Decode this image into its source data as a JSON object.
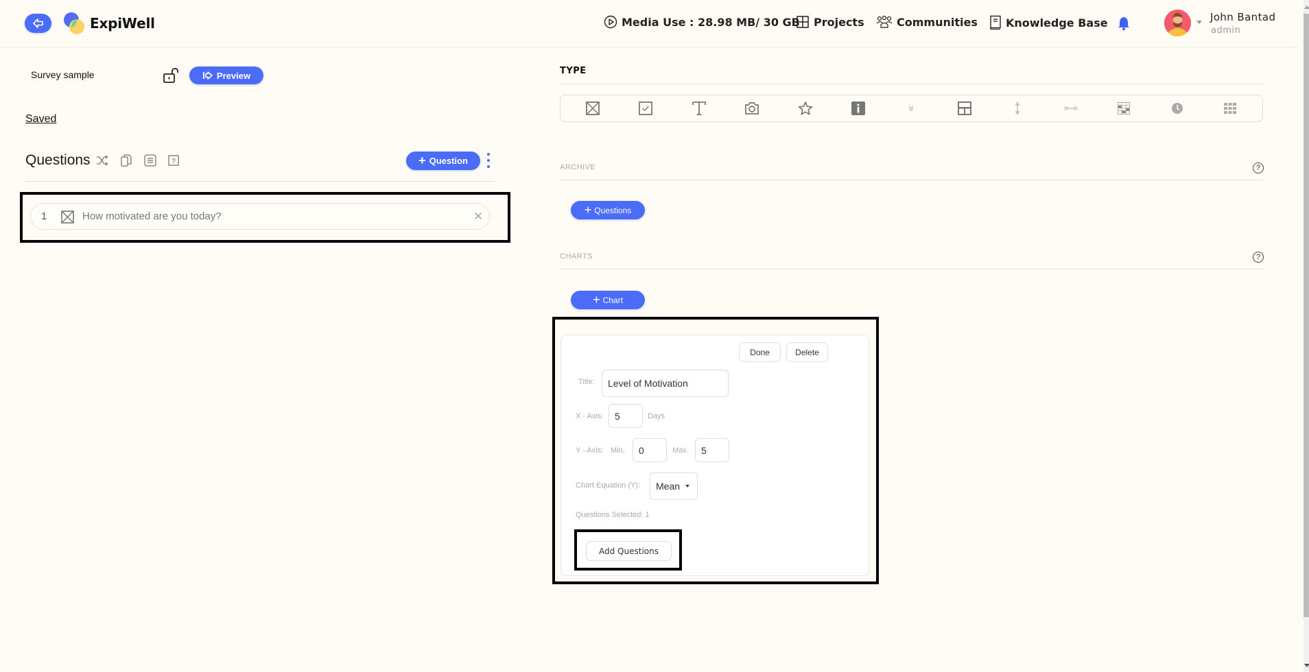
{
  "header": {
    "brand": "ExpiWell",
    "media_use": "Media Use : 28.98 MB/ 30 GB",
    "nav": [
      {
        "label": "Projects",
        "icon": "grid-icon"
      },
      {
        "label": "Communities",
        "icon": "people-icon"
      },
      {
        "label": "Knowledge Base",
        "icon": "book-icon"
      }
    ],
    "user": {
      "name": "John Bantad",
      "role": "admin"
    }
  },
  "colors": {
    "accent": "#4a6cf7",
    "background": "#fffcf5"
  },
  "left": {
    "survey_name": "Survey sample",
    "preview_label": "Preview",
    "saved_label": "Saved",
    "questions_heading": "Questions",
    "add_question_label": "Question",
    "questions": [
      {
        "number": "1",
        "type": "multiple-choice",
        "text": "How motivated are you today?"
      }
    ]
  },
  "right": {
    "type_title": "TYPE",
    "type_tools": [
      "multiple-choice",
      "checkbox",
      "text",
      "photo",
      "rating",
      "info",
      "dropdown",
      "layout",
      "vertical-slider",
      "horizontal-slider",
      "matrix",
      "time",
      "grid"
    ],
    "archive_title": "ARCHIVE",
    "archive_button": "Questions",
    "charts_title": "CHARTS",
    "chart_button": "Chart",
    "chart_editor": {
      "done_label": "Done",
      "delete_label": "Delete",
      "title_label": "Title:",
      "title_value": "Level of Motivation",
      "x_axis_label": "X - Axis:",
      "x_axis_value": "5",
      "x_axis_unit": "Days",
      "y_axis_label": "Y - Axis:",
      "y_min_label": "Min.",
      "y_min_value": "0",
      "y_max_label": "Max.",
      "y_max_value": "5",
      "equation_label": "Chart Equation (Y):",
      "equation_value": "Mean",
      "questions_selected": "Questions Selected: 1",
      "add_questions_label": "Add Questions"
    }
  }
}
